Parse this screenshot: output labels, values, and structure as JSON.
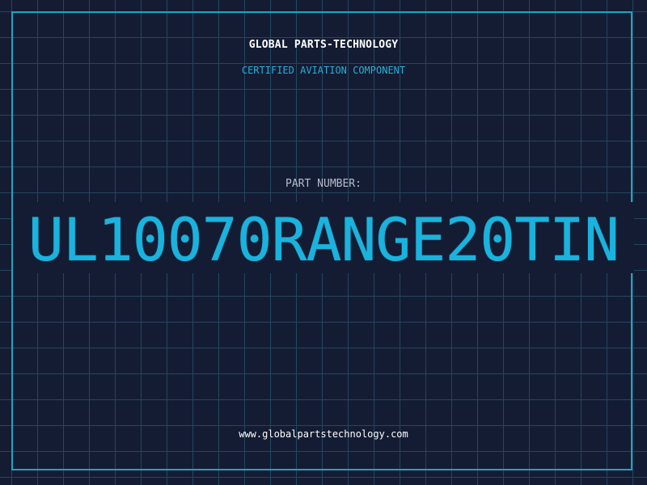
{
  "header": {
    "company": "GLOBAL PARTS-TECHNOLOGY",
    "subtitle": "CERTIFIED AVIATION COMPONENT"
  },
  "part": {
    "label": "PART NUMBER:",
    "number": "UL10070RANGE20TIN"
  },
  "footer": {
    "website": "www.globalpartstechnology.com"
  },
  "colors": {
    "background": "#141c33",
    "grid": "#23465e",
    "frame": "#1fa3c4",
    "accent": "#1ab3dd",
    "subtitle": "#2aaed6",
    "label": "#b6bfcc",
    "text": "#ffffff"
  }
}
